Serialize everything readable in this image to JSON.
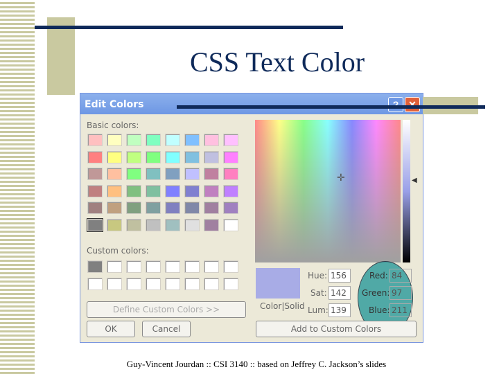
{
  "slide": {
    "title": "CSS Text Color",
    "footer": "Guy-Vincent Jourdan :: CSI 3140 :: based on Jeffrey C. Jackson’s slides"
  },
  "dialog": {
    "title": "Edit Colors",
    "help": "?",
    "close": "✕",
    "basic_label": "Basic colors:",
    "custom_label": "Custom colors:",
    "basic_colors": [
      "#ffc0c0",
      "#ffffc0",
      "#c0ffc0",
      "#80ffc0",
      "#c0ffff",
      "#80c0ff",
      "#ffc0e0",
      "#ffc0ff",
      "#ff8080",
      "#ffff80",
      "#c0ff80",
      "#80ff80",
      "#80ffff",
      "#80c0e0",
      "#c0c0e0",
      "#ff80ff",
      "#c09898",
      "#ffc0a0",
      "#80ff80",
      "#80c0c0",
      "#80a0c0",
      "#c0c0ff",
      "#c080a0",
      "#ff80c0",
      "#c08080",
      "#ffc080",
      "#80c080",
      "#80c0a0",
      "#8080ff",
      "#8080d0",
      "#c080c0",
      "#c080ff",
      "#a08080",
      "#c0a080",
      "#80a080",
      "#80a0a0",
      "#8080c0",
      "#8088a8",
      "#a080a0",
      "#a080c0",
      "#808080",
      "#c8c880",
      "#c0c0a0",
      "#c0c0c0",
      "#a0c0c0",
      "#e0e0e0",
      "#a080a0",
      "#ffffff"
    ],
    "custom_colors": [
      "#808080",
      "#fff",
      "#fff",
      "#fff",
      "#fff",
      "#fff",
      "#fff",
      "#fff",
      "#fff",
      "#fff",
      "#fff",
      "#fff",
      "#fff",
      "#fff",
      "#fff",
      "#fff"
    ],
    "define_custom": "Define Custom Colors >>",
    "ok": "OK",
    "cancel": "Cancel",
    "color_solid": "Color|Solid",
    "preview_color": "#a8ace6",
    "hue_label": "Hue:",
    "hue": "156",
    "sat_label": "Sat:",
    "sat": "142",
    "lum_label": "Lum:",
    "lum": "139",
    "red_label": "Red:",
    "red": "84",
    "green_label": "Green:",
    "green": "97",
    "blue_label": "Blue:",
    "blue": "211",
    "add_custom": "Add to Custom Colors",
    "highlight_color": "#2a9a9a"
  }
}
